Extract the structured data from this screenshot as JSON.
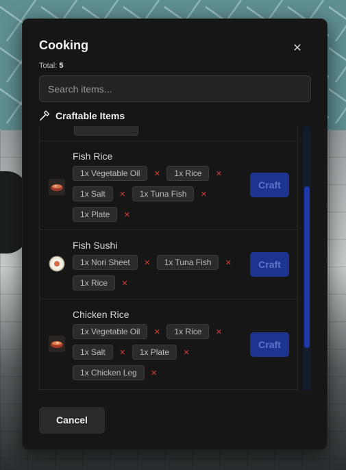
{
  "modal": {
    "title": "Cooking",
    "close_icon": "close-icon",
    "total_label": "Total:",
    "total_count": "5"
  },
  "search": {
    "placeholder": "Search items..."
  },
  "section": {
    "icon": "hammer-icon",
    "label": "Craftable Items"
  },
  "recipes": [
    {
      "name": "Fish Rice",
      "icon": "fish-rice-bowl-icon",
      "ingredients": [
        "1x Vegetable Oil",
        "1x Rice",
        "1x Salt",
        "1x Tuna Fish",
        "1x Plate"
      ],
      "craft_label": "Craft"
    },
    {
      "name": "Fish Sushi",
      "icon": "fish-sushi-icon",
      "ingredients": [
        "1x Nori Sheet",
        "1x Tuna Fish",
        "1x Rice"
      ],
      "craft_label": "Craft"
    },
    {
      "name": "Chicken Rice",
      "icon": "chicken-rice-bowl-icon",
      "ingredients": [
        "1x Vegetable Oil",
        "1x Rice",
        "1x Salt",
        "1x Plate",
        "1x Chicken Leg"
      ],
      "craft_label": "Craft"
    }
  ],
  "missing_marker": "✕",
  "cancel_label": "Cancel",
  "colors": {
    "craft_button": "#1c3490",
    "missing_marker": "#d23c3c",
    "scrollbar": "#1f3aa6"
  }
}
